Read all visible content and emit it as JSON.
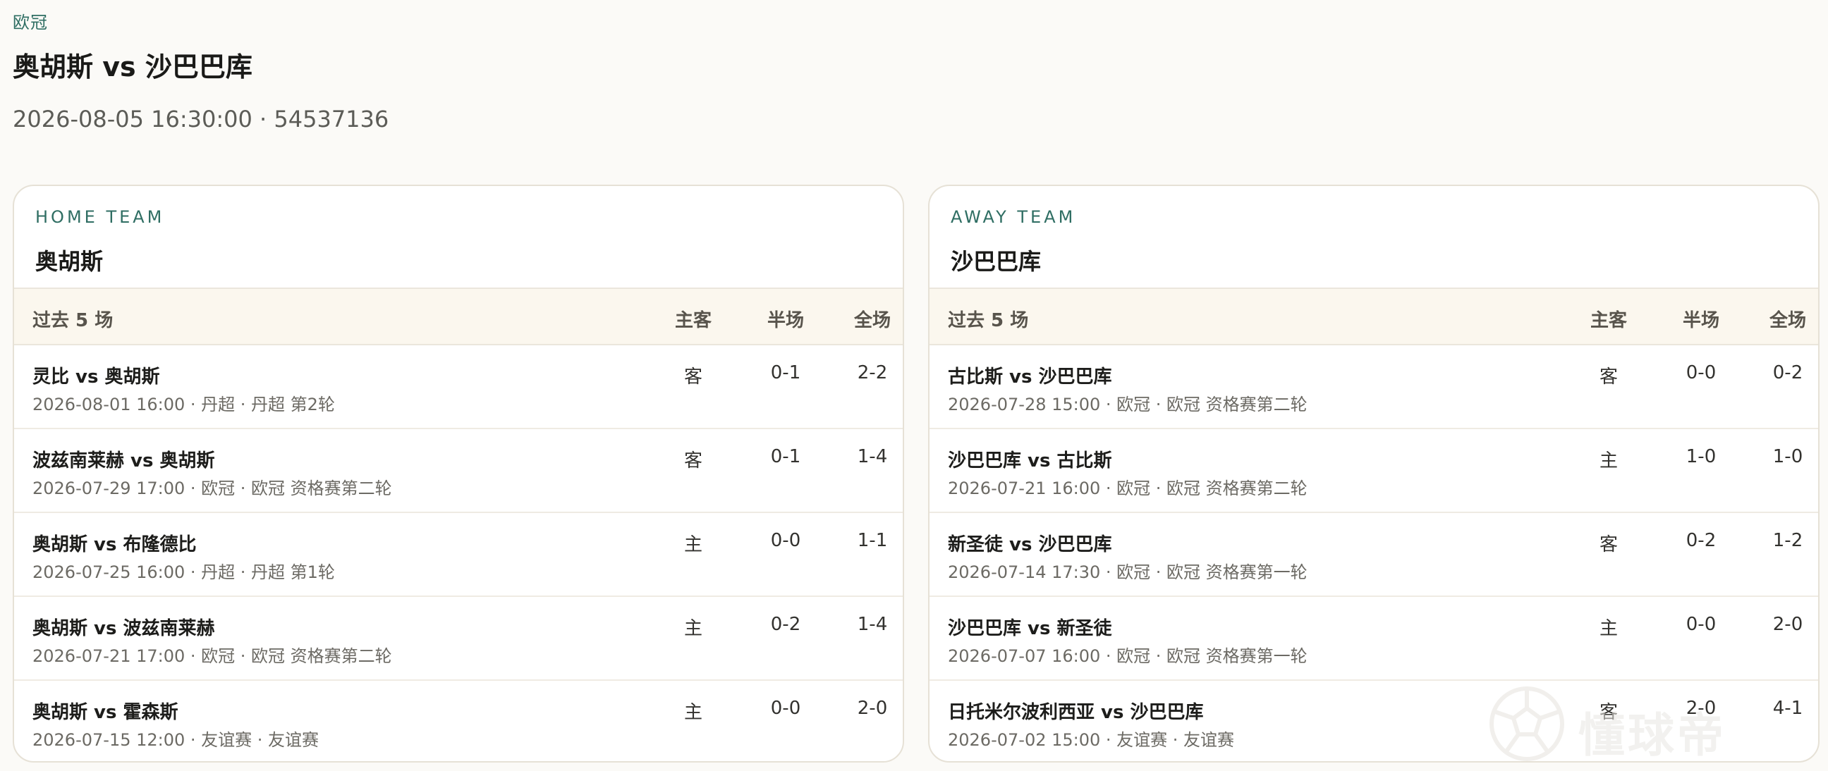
{
  "league": "欧冠",
  "match": {
    "title": "奥胡斯 vs 沙巴巴库",
    "meta": "2026-08-05 16:30:00 · 54537136"
  },
  "home": {
    "role": "HOME TEAM",
    "name": "奥胡斯",
    "headers": {
      "recent": "过去 5 场",
      "ha": "主客",
      "half": "半场",
      "full": "全场"
    },
    "rows": [
      {
        "fixture": "灵比 vs 奥胡斯",
        "meta": "2026-08-01 16:00 · 丹超 · 丹超 第2轮",
        "ha": "客",
        "half": "0-1",
        "full": "2-2"
      },
      {
        "fixture": "波兹南莱赫 vs 奥胡斯",
        "meta": "2026-07-29 17:00 · 欧冠 · 欧冠 资格赛第二轮",
        "ha": "客",
        "half": "0-1",
        "full": "1-4"
      },
      {
        "fixture": "奥胡斯 vs 布隆德比",
        "meta": "2026-07-25 16:00 · 丹超 · 丹超 第1轮",
        "ha": "主",
        "half": "0-0",
        "full": "1-1"
      },
      {
        "fixture": "奥胡斯 vs 波兹南莱赫",
        "meta": "2026-07-21 17:00 · 欧冠 · 欧冠 资格赛第二轮",
        "ha": "主",
        "half": "0-2",
        "full": "1-4"
      },
      {
        "fixture": "奥胡斯 vs 霍森斯",
        "meta": "2026-07-15 12:00 · 友谊赛 · 友谊赛",
        "ha": "主",
        "half": "0-0",
        "full": "2-0"
      }
    ]
  },
  "away": {
    "role": "AWAY TEAM",
    "name": "沙巴巴库",
    "headers": {
      "recent": "过去 5 场",
      "ha": "主客",
      "half": "半场",
      "full": "全场"
    },
    "rows": [
      {
        "fixture": "古比斯 vs 沙巴巴库",
        "meta": "2026-07-28 15:00 · 欧冠 · 欧冠 资格赛第二轮",
        "ha": "客",
        "half": "0-0",
        "full": "0-2"
      },
      {
        "fixture": "沙巴巴库 vs 古比斯",
        "meta": "2026-07-21 16:00 · 欧冠 · 欧冠 资格赛第二轮",
        "ha": "主",
        "half": "1-0",
        "full": "1-0"
      },
      {
        "fixture": "新圣徒 vs 沙巴巴库",
        "meta": "2026-07-14 17:30 · 欧冠 · 欧冠 资格赛第一轮",
        "ha": "客",
        "half": "0-2",
        "full": "1-2"
      },
      {
        "fixture": "沙巴巴库 vs 新圣徒",
        "meta": "2026-07-07 16:00 · 欧冠 · 欧冠 资格赛第一轮",
        "ha": "主",
        "half": "0-0",
        "full": "2-0"
      },
      {
        "fixture": "日托米尔波利西亚 vs 沙巴巴库",
        "meta": "2026-07-02 15:00 · 友谊赛 · 友谊赛",
        "ha": "客",
        "half": "2-0",
        "full": "4-1"
      }
    ]
  },
  "watermark": {
    "text": "懂球帝",
    "icon": "soccer-ball-icon"
  }
}
